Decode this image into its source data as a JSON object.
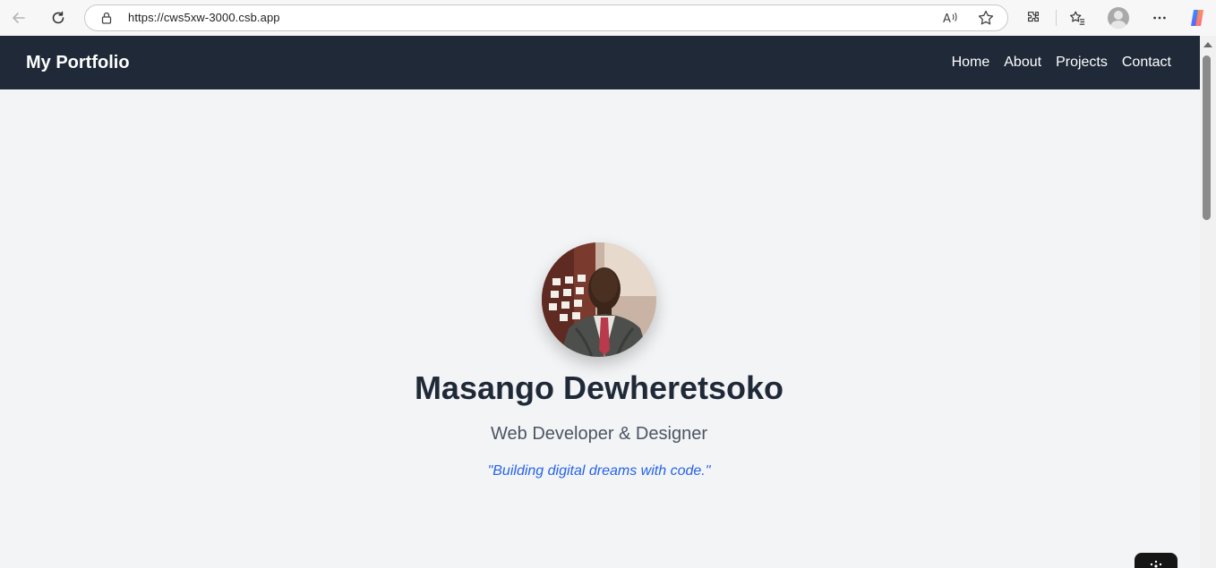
{
  "browser": {
    "url": "https://cws5xw-3000.csb.app",
    "icons": [
      "back-arrow-icon",
      "refresh-icon",
      "lock-icon",
      "read-aloud-icon",
      "favorite-star-icon",
      "extensions-icon",
      "favorites-list-icon",
      "profile-icon",
      "more-options-icon",
      "copilot-icon"
    ]
  },
  "nav": {
    "brand": "My Portfolio",
    "links": [
      "Home",
      "About",
      "Projects",
      "Contact"
    ]
  },
  "hero": {
    "name": "Masango Dewheretsoko",
    "role": "Web Developer & Designer",
    "quote": "\"Building digital dreams with code.\""
  },
  "colors": {
    "nav_bg": "#1f2937",
    "page_bg": "#f3f4f6",
    "name": "#1f2937",
    "role": "#4b5563",
    "quote": "#2563eb"
  }
}
